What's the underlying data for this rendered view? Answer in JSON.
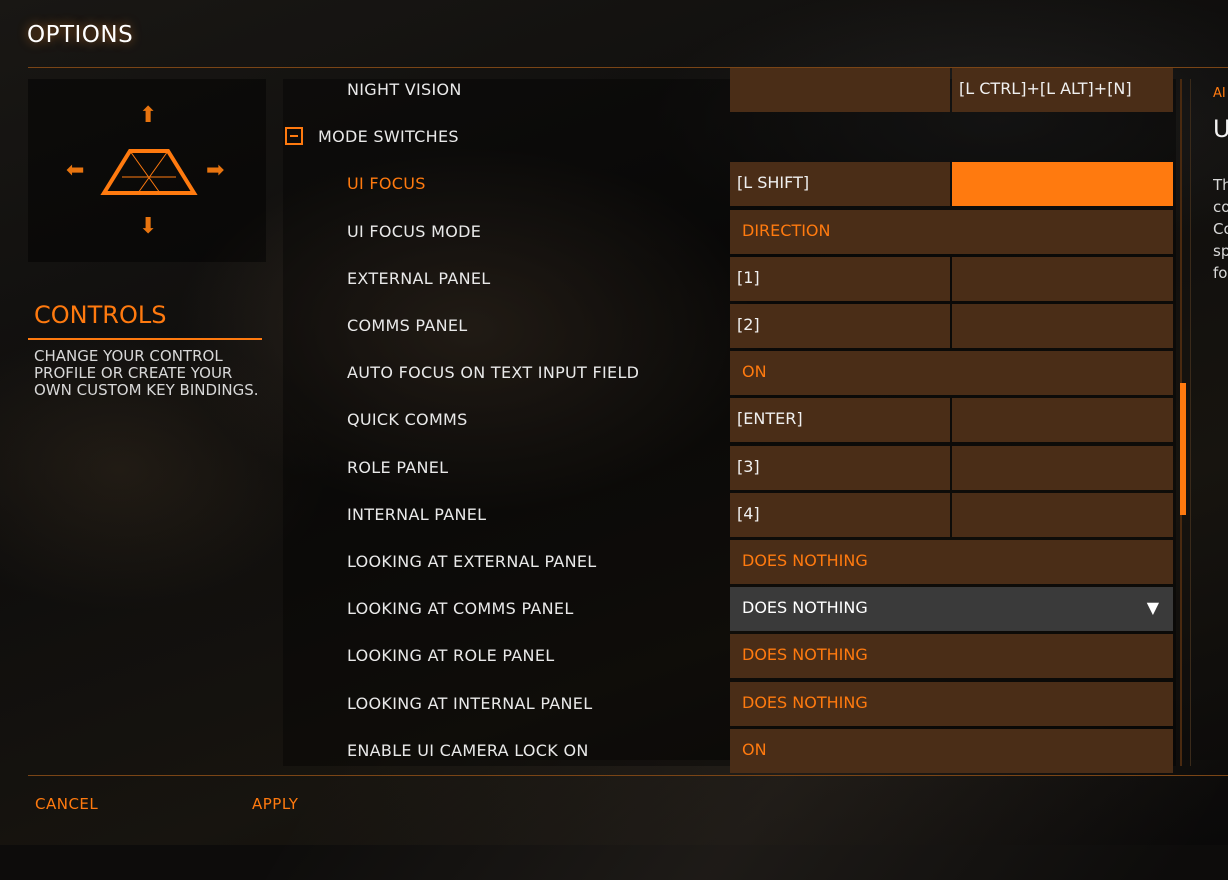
{
  "window": {
    "title": "OPTIONS"
  },
  "left_panel": {
    "section_title": "CONTROLS",
    "description": "CHANGE YOUR CONTROL PROFILE OR CREATE YOUR OWN CUSTOM KEY BINDINGS."
  },
  "bindings": {
    "rows": [
      {
        "label": "NIGHT VISION",
        "kind": "keys",
        "primary": "",
        "secondary": "[L CTRL]+[L ALT]+[N]"
      },
      {
        "label": "MODE SWITCHES",
        "kind": "section"
      },
      {
        "label": "UI FOCUS",
        "kind": "keys",
        "primary": "[L SHIFT]",
        "secondary": "",
        "active": true
      },
      {
        "label": "UI FOCUS MODE",
        "kind": "option",
        "value": "DIRECTION"
      },
      {
        "label": "EXTERNAL PANEL",
        "kind": "keys",
        "primary": "[1]",
        "secondary": ""
      },
      {
        "label": "COMMS PANEL",
        "kind": "keys",
        "primary": "[2]",
        "secondary": ""
      },
      {
        "label": "AUTO FOCUS ON TEXT INPUT FIELD",
        "kind": "option",
        "value": "ON"
      },
      {
        "label": "QUICK COMMS",
        "kind": "keys",
        "primary": "[ENTER]",
        "secondary": ""
      },
      {
        "label": "ROLE PANEL",
        "kind": "keys",
        "primary": "[3]",
        "secondary": ""
      },
      {
        "label": "INTERNAL PANEL",
        "kind": "keys",
        "primary": "[4]",
        "secondary": ""
      },
      {
        "label": "LOOKING AT EXTERNAL PANEL",
        "kind": "option",
        "value": "DOES NOTHING"
      },
      {
        "label": "LOOKING AT COMMS PANEL",
        "kind": "dropdown",
        "value": "DOES NOTHING"
      },
      {
        "label": "LOOKING AT ROLE PANEL",
        "kind": "option",
        "value": "DOES NOTHING"
      },
      {
        "label": "LOOKING AT INTERNAL PANEL",
        "kind": "option",
        "value": "DOES NOTHING"
      },
      {
        "label": "ENABLE UI CAMERA LOCK ON",
        "kind": "option",
        "value": "ON"
      }
    ]
  },
  "info_panel": {
    "small": "AI",
    "big": "U",
    "body": [
      "Th",
      "co",
      "Co",
      "sp",
      "fo"
    ]
  },
  "footer": {
    "cancel": "CANCEL",
    "apply": "APPLY"
  },
  "colors": {
    "accent": "#ff7a0f",
    "cell": "#4a2d17",
    "dropdown": "#3a3a3a"
  },
  "icons": {
    "up": "arrow-up-icon",
    "down": "arrow-down-icon",
    "left": "arrow-left-icon",
    "right": "arrow-right-icon",
    "ship": "ship-outline-icon",
    "collapse": "minus-square-icon",
    "dropdown": "triangle-down-icon"
  }
}
